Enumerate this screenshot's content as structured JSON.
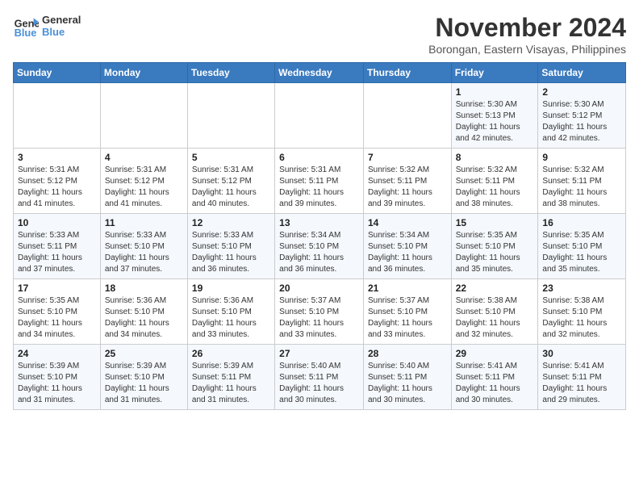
{
  "header": {
    "logo_line1": "General",
    "logo_line2": "Blue",
    "month_title": "November 2024",
    "location": "Borongan, Eastern Visayas, Philippines"
  },
  "weekdays": [
    "Sunday",
    "Monday",
    "Tuesday",
    "Wednesday",
    "Thursday",
    "Friday",
    "Saturday"
  ],
  "weeks": [
    [
      {
        "day": "",
        "info": ""
      },
      {
        "day": "",
        "info": ""
      },
      {
        "day": "",
        "info": ""
      },
      {
        "day": "",
        "info": ""
      },
      {
        "day": "",
        "info": ""
      },
      {
        "day": "1",
        "info": "Sunrise: 5:30 AM\nSunset: 5:13 PM\nDaylight: 11 hours\nand 42 minutes."
      },
      {
        "day": "2",
        "info": "Sunrise: 5:30 AM\nSunset: 5:12 PM\nDaylight: 11 hours\nand 42 minutes."
      }
    ],
    [
      {
        "day": "3",
        "info": "Sunrise: 5:31 AM\nSunset: 5:12 PM\nDaylight: 11 hours\nand 41 minutes."
      },
      {
        "day": "4",
        "info": "Sunrise: 5:31 AM\nSunset: 5:12 PM\nDaylight: 11 hours\nand 41 minutes."
      },
      {
        "day": "5",
        "info": "Sunrise: 5:31 AM\nSunset: 5:12 PM\nDaylight: 11 hours\nand 40 minutes."
      },
      {
        "day": "6",
        "info": "Sunrise: 5:31 AM\nSunset: 5:11 PM\nDaylight: 11 hours\nand 39 minutes."
      },
      {
        "day": "7",
        "info": "Sunrise: 5:32 AM\nSunset: 5:11 PM\nDaylight: 11 hours\nand 39 minutes."
      },
      {
        "day": "8",
        "info": "Sunrise: 5:32 AM\nSunset: 5:11 PM\nDaylight: 11 hours\nand 38 minutes."
      },
      {
        "day": "9",
        "info": "Sunrise: 5:32 AM\nSunset: 5:11 PM\nDaylight: 11 hours\nand 38 minutes."
      }
    ],
    [
      {
        "day": "10",
        "info": "Sunrise: 5:33 AM\nSunset: 5:11 PM\nDaylight: 11 hours\nand 37 minutes."
      },
      {
        "day": "11",
        "info": "Sunrise: 5:33 AM\nSunset: 5:10 PM\nDaylight: 11 hours\nand 37 minutes."
      },
      {
        "day": "12",
        "info": "Sunrise: 5:33 AM\nSunset: 5:10 PM\nDaylight: 11 hours\nand 36 minutes."
      },
      {
        "day": "13",
        "info": "Sunrise: 5:34 AM\nSunset: 5:10 PM\nDaylight: 11 hours\nand 36 minutes."
      },
      {
        "day": "14",
        "info": "Sunrise: 5:34 AM\nSunset: 5:10 PM\nDaylight: 11 hours\nand 36 minutes."
      },
      {
        "day": "15",
        "info": "Sunrise: 5:35 AM\nSunset: 5:10 PM\nDaylight: 11 hours\nand 35 minutes."
      },
      {
        "day": "16",
        "info": "Sunrise: 5:35 AM\nSunset: 5:10 PM\nDaylight: 11 hours\nand 35 minutes."
      }
    ],
    [
      {
        "day": "17",
        "info": "Sunrise: 5:35 AM\nSunset: 5:10 PM\nDaylight: 11 hours\nand 34 minutes."
      },
      {
        "day": "18",
        "info": "Sunrise: 5:36 AM\nSunset: 5:10 PM\nDaylight: 11 hours\nand 34 minutes."
      },
      {
        "day": "19",
        "info": "Sunrise: 5:36 AM\nSunset: 5:10 PM\nDaylight: 11 hours\nand 33 minutes."
      },
      {
        "day": "20",
        "info": "Sunrise: 5:37 AM\nSunset: 5:10 PM\nDaylight: 11 hours\nand 33 minutes."
      },
      {
        "day": "21",
        "info": "Sunrise: 5:37 AM\nSunset: 5:10 PM\nDaylight: 11 hours\nand 33 minutes."
      },
      {
        "day": "22",
        "info": "Sunrise: 5:38 AM\nSunset: 5:10 PM\nDaylight: 11 hours\nand 32 minutes."
      },
      {
        "day": "23",
        "info": "Sunrise: 5:38 AM\nSunset: 5:10 PM\nDaylight: 11 hours\nand 32 minutes."
      }
    ],
    [
      {
        "day": "24",
        "info": "Sunrise: 5:39 AM\nSunset: 5:10 PM\nDaylight: 11 hours\nand 31 minutes."
      },
      {
        "day": "25",
        "info": "Sunrise: 5:39 AM\nSunset: 5:10 PM\nDaylight: 11 hours\nand 31 minutes."
      },
      {
        "day": "26",
        "info": "Sunrise: 5:39 AM\nSunset: 5:11 PM\nDaylight: 11 hours\nand 31 minutes."
      },
      {
        "day": "27",
        "info": "Sunrise: 5:40 AM\nSunset: 5:11 PM\nDaylight: 11 hours\nand 30 minutes."
      },
      {
        "day": "28",
        "info": "Sunrise: 5:40 AM\nSunset: 5:11 PM\nDaylight: 11 hours\nand 30 minutes."
      },
      {
        "day": "29",
        "info": "Sunrise: 5:41 AM\nSunset: 5:11 PM\nDaylight: 11 hours\nand 30 minutes."
      },
      {
        "day": "30",
        "info": "Sunrise: 5:41 AM\nSunset: 5:11 PM\nDaylight: 11 hours\nand 29 minutes."
      }
    ]
  ]
}
